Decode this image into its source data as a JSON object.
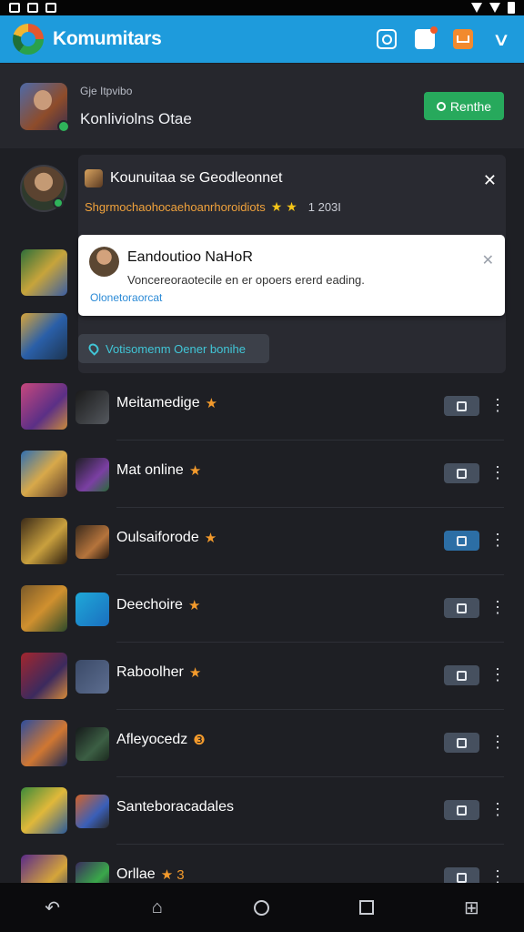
{
  "app": {
    "title": "Komumitars"
  },
  "appbar": {
    "icons": [
      "camera-icon",
      "shield-icon",
      "inbox-icon",
      "chevron-down-icon"
    ]
  },
  "profile": {
    "subtitle": "Gje Itpvibo",
    "name": "Konliviolns Otae",
    "follow_label": "Renthe"
  },
  "notification": {
    "title": "Kounuitaa se Geodleonnet",
    "subline": "Shgrmochaohocaehoanrhoroidiots",
    "stars": "★ ★",
    "count": "1 203I"
  },
  "popup": {
    "title": "Eandoutioo NaHoR",
    "desc": "Voncereoraotecile en er opoers ererd eading.",
    "link": "Olonetoraorcat"
  },
  "action": {
    "label": "Votisomenm Oener bonihe"
  },
  "rows": [
    {
      "label": "Meitamedige",
      "badge": "★",
      "active": false
    },
    {
      "label": "Mat online",
      "badge": "★",
      "active": false
    },
    {
      "label": "Oulsaiforode",
      "badge": "★",
      "active": true
    },
    {
      "label": "Deechoire",
      "badge": "★",
      "active": false
    },
    {
      "label": "Raboolher",
      "badge": "★",
      "active": false
    },
    {
      "label": "Afleyocedz",
      "badge": "❸",
      "active": false
    },
    {
      "label": "Santeboracadales",
      "badge": "",
      "active": false
    },
    {
      "label": "Orllae",
      "badge": "★ 3",
      "active": false
    }
  ],
  "colors": {
    "accent": "#1e9bdc",
    "follow": "#27a95c",
    "star": "#f39a2c",
    "link": "#2b8ad6"
  },
  "navbar": {
    "icons": [
      "back-icon",
      "home-icon",
      "circle-home-icon",
      "recents-icon",
      "apps-icon"
    ]
  }
}
